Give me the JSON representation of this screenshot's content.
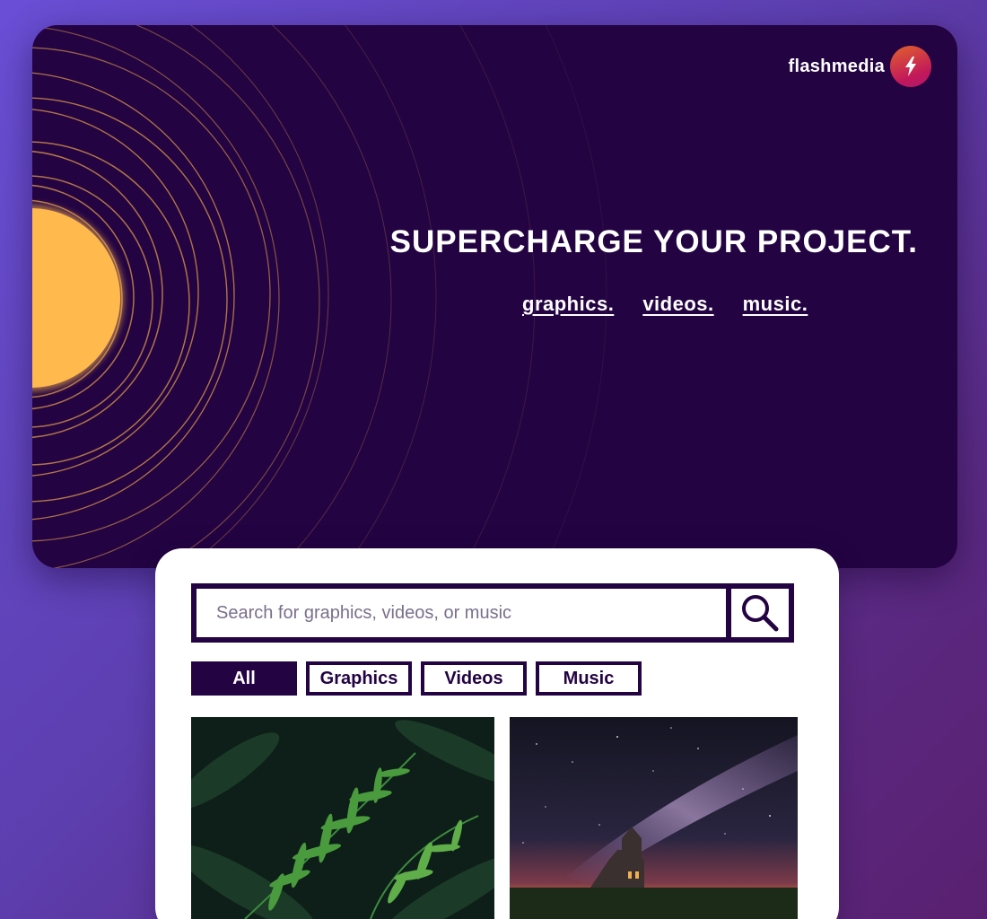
{
  "brand": {
    "name": "flashmedia",
    "logo_icon": "lightning-bolt-icon",
    "logo_gradient": [
      "#e0622a",
      "#c2185b"
    ]
  },
  "hero": {
    "headline": "SUPERCHARGE YOUR PROJECT.",
    "links": [
      "graphics.",
      "videos.",
      "music."
    ],
    "background_color": "#230342",
    "sun_color": "#ffb94d",
    "ring_color": "#c98a4a"
  },
  "search": {
    "placeholder": "Search for graphics, videos, or music",
    "value": "",
    "button_icon": "search-icon"
  },
  "filters": [
    {
      "label": "All",
      "active": true
    },
    {
      "label": "Graphics",
      "active": false
    },
    {
      "label": "Videos",
      "active": false
    },
    {
      "label": "Music",
      "active": false
    }
  ],
  "results": [
    {
      "type": "image",
      "subject": "fern-leaves"
    },
    {
      "type": "image",
      "subject": "church-under-milky-way"
    }
  ],
  "colors": {
    "primary": "#230342",
    "page_gradient": [
      "#6a4fd6",
      "#5a2070"
    ],
    "panel": "#ffffff"
  }
}
